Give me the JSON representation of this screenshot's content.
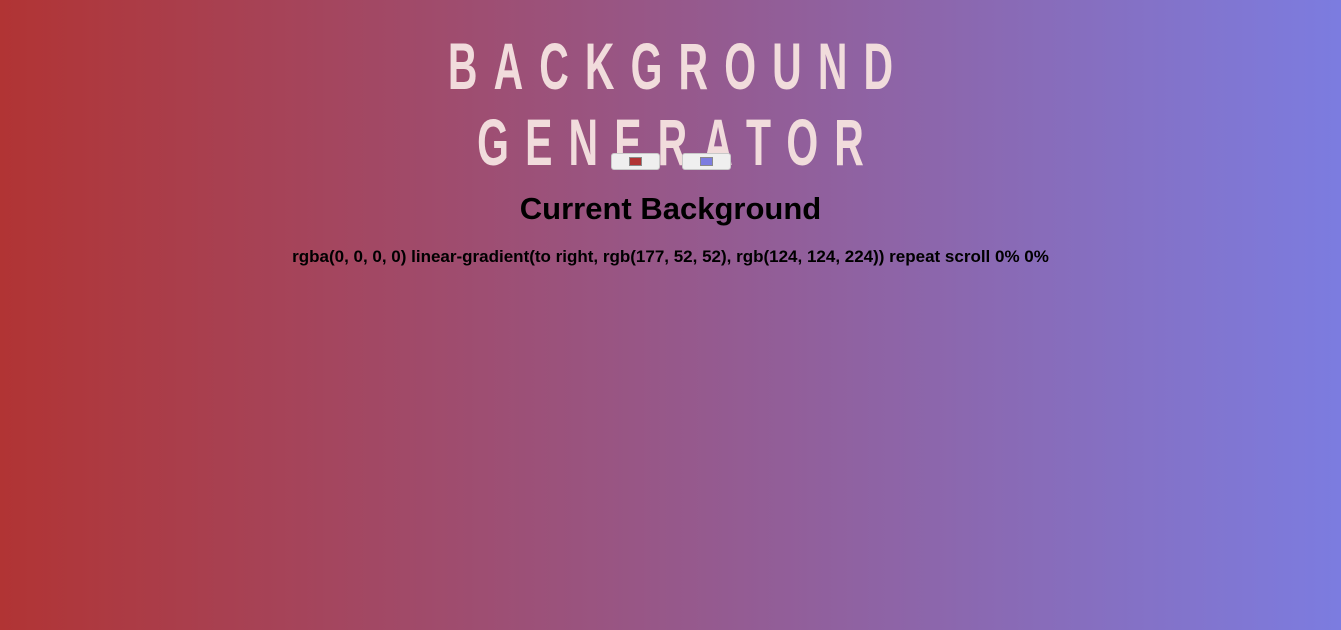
{
  "title": "BACKGROUND GENERATOR",
  "pickers": {
    "color1": {
      "value": "#b13434"
    },
    "color2": {
      "value": "#7c7ce0"
    }
  },
  "heading": "Current Background",
  "css_text": "rgba(0, 0, 0, 0) linear-gradient(to right, rgb(177, 52, 52), rgb(124, 124, 224)) repeat scroll 0% 0%"
}
